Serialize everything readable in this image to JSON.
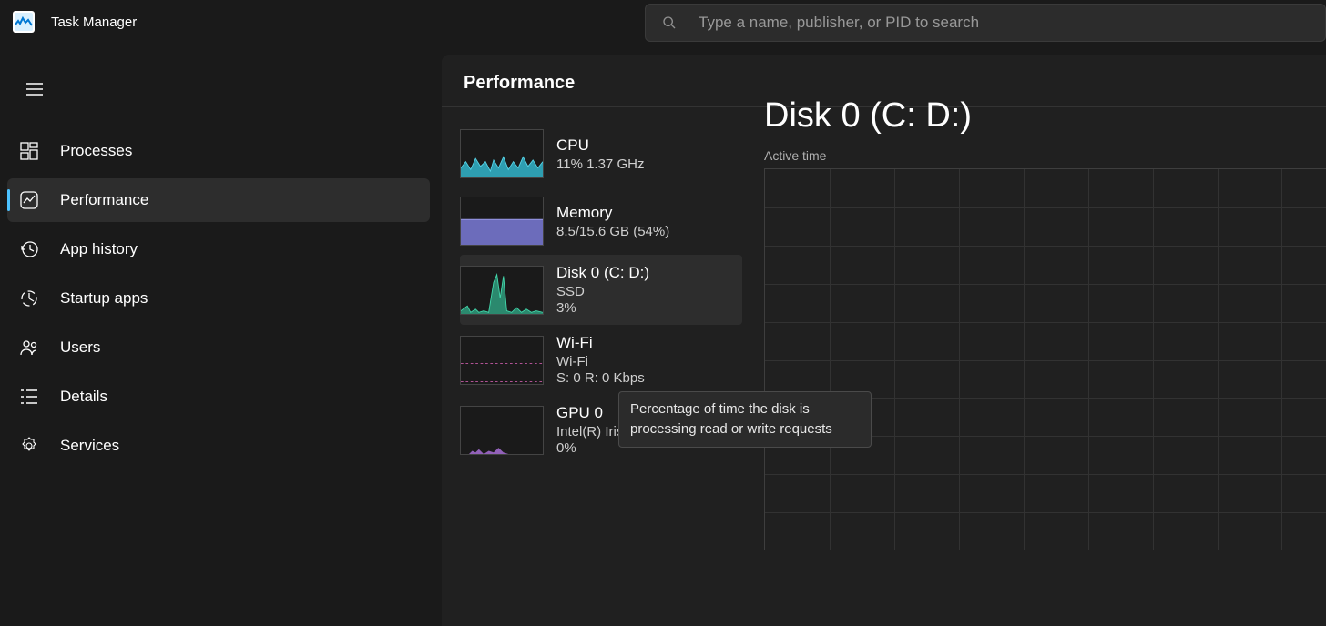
{
  "app": {
    "title": "Task Manager"
  },
  "search": {
    "placeholder": "Type a name, publisher, or PID to search"
  },
  "sidebar": {
    "items": [
      {
        "id": "processes",
        "label": "Processes"
      },
      {
        "id": "performance",
        "label": "Performance"
      },
      {
        "id": "apphistory",
        "label": "App history"
      },
      {
        "id": "startup",
        "label": "Startup apps"
      },
      {
        "id": "users",
        "label": "Users"
      },
      {
        "id": "details",
        "label": "Details"
      },
      {
        "id": "services",
        "label": "Services"
      }
    ],
    "active": "performance"
  },
  "page": {
    "title": "Performance"
  },
  "perf_items": [
    {
      "id": "cpu",
      "name": "CPU",
      "sub1": "11%  1.37 GHz",
      "sub2": "",
      "color": "#33b6cc"
    },
    {
      "id": "mem",
      "name": "Memory",
      "sub1": "8.5/15.6 GB (54%)",
      "sub2": "",
      "color": "#7b7bd8"
    },
    {
      "id": "disk0",
      "name": "Disk 0 (C: D:)",
      "sub1": "SSD",
      "sub2": "3%",
      "color": "#2fa583"
    },
    {
      "id": "wifi",
      "name": "Wi-Fi",
      "sub1": "Wi-Fi",
      "sub2": "S: 0  R: 0 Kbps",
      "color": "#c65aa5"
    },
    {
      "id": "gpu0",
      "name": "GPU 0",
      "sub1": "Intel(R) Iris(R) Plus Gra...",
      "sub2": "0%",
      "color": "#a86fd6"
    }
  ],
  "perf_selected": "disk0",
  "detail": {
    "title": "Disk 0 (C: D:)",
    "chart_label": "Active time"
  },
  "tooltip": {
    "text": "Percentage of time the disk is processing read or write requests"
  }
}
